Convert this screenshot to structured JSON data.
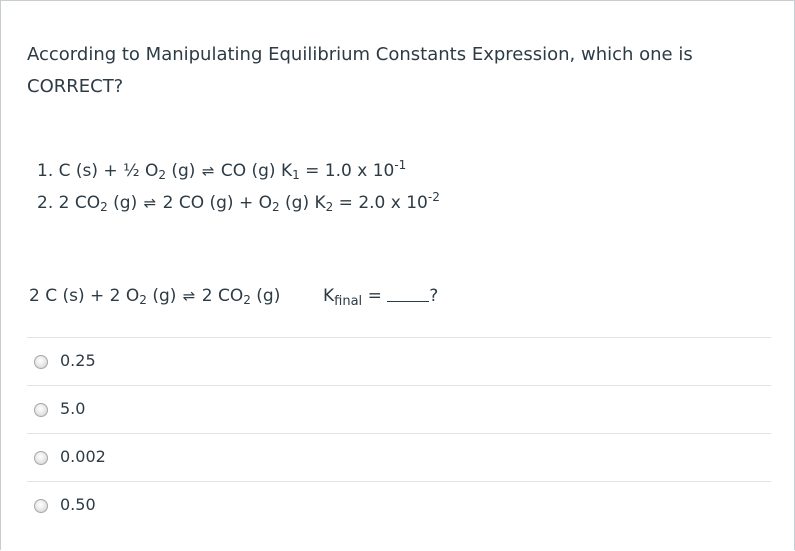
{
  "question": {
    "text": "According to Manipulating Equilibrium Constants Expression, which one is CORRECT?"
  },
  "equations": {
    "eq1": {
      "prefix": "1. C (s) + ½ O",
      "sub1": "2",
      "mid": " (g) ",
      "arrow": "⇌",
      "rest": " CO (g) K",
      "ksub": "1",
      "value": " = 1.0 x 10",
      "exp": "-1"
    },
    "eq2": {
      "prefix": "2. 2 CO",
      "sub1": "2",
      "mid": " (g) ",
      "arrow": "⇌",
      "rest1": " 2 CO (g) + O",
      "sub2": "2",
      "rest2": " (g) K",
      "ksub": "2",
      "value": " = 2.0 x 10",
      "exp": "-2"
    },
    "target": {
      "prefix": "2 C (s) + 2 O",
      "sub1": "2",
      "mid": " (g) ",
      "arrow": "⇌",
      "rest": " 2 CO",
      "sub2": "2",
      "end": " (g)"
    },
    "kfinal": {
      "k": "K",
      "ksub": "final",
      "equals": " = ",
      "q": "?"
    }
  },
  "answers": [
    {
      "label": "0.25",
      "selected": false
    },
    {
      "label": "5.0",
      "selected": false
    },
    {
      "label": "0.002",
      "selected": false
    },
    {
      "label": "0.50",
      "selected": false
    }
  ]
}
